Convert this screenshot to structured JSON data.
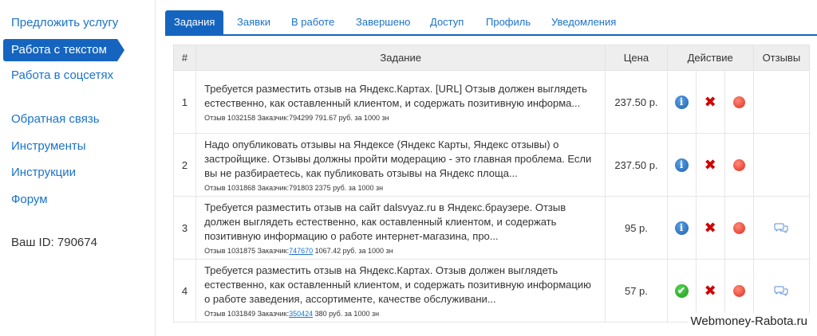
{
  "sidebar": {
    "items": [
      {
        "label": "Предложить услугу"
      },
      {
        "label": "Работа с текстом"
      },
      {
        "label": "Работа в соцсетях"
      },
      {
        "label": "Обратная связь"
      },
      {
        "label": "Инструменты"
      },
      {
        "label": "Инструкции"
      },
      {
        "label": "Форум"
      }
    ],
    "user_id": "Ваш ID: 790674"
  },
  "tabs": [
    {
      "label": "Задания"
    },
    {
      "label": "Заявки"
    },
    {
      "label": "В работе"
    },
    {
      "label": "Завершено"
    },
    {
      "label": "Доступ"
    },
    {
      "label": "Профиль"
    },
    {
      "label": "Уведомления"
    }
  ],
  "table": {
    "headers": {
      "num": "#",
      "task": "Задание",
      "price": "Цена",
      "action": "Действие",
      "reviews": "Отзывы"
    },
    "rows": [
      {
        "num": "1",
        "text": "Требуется разместить отзыв на Яндекс.Картах. [URL] Отзыв должен выглядеть естественно, как оставленный клиентом, и содержать позитивную информа...",
        "meta_prefix": "Отзыв 1032158 Заказчик:",
        "client": "794299",
        "meta_suffix": " 791.67 руб. за 1000 зн",
        "price": "237.50 р.",
        "status": "info"
      },
      {
        "num": "2",
        "text": "Надо опубликовать отзывы на Яндексе (Яндекс Карты, Яндекс отзывы) о застройщике. Отзывы должны пройти модерацию - это главная проблема. Если вы не разбираетесь, как публиковать отзывы на Яндекс площа...",
        "meta_prefix": "Отзыв 1031868 Заказчик:",
        "client": "791803",
        "meta_suffix": " 2375 руб. за 1000 зн",
        "price": "237.50 р.",
        "status": "info"
      },
      {
        "num": "3",
        "text": "Требуется разместить отзыв на сайт dalsvyaz.ru в Яндекс.браузере. Отзыв должен выглядеть естественно, как оставленный клиентом, и содержать позитивную информацию о работе интернет-магазина, про...",
        "meta_prefix": "Отзыв 1031875 Заказчик:",
        "client": "747670",
        "meta_suffix": " 1067.42 руб. за 1000 зн",
        "price": "95 р.",
        "status": "info"
      },
      {
        "num": "4",
        "text": "Требуется разместить отзыв на Яндекс.Картах. Отзыв должен выглядеть естественно, как оставленный клиентом, и содержать позитивную информацию о работе заведения, ассортименте, качестве обслуживани...",
        "meta_prefix": "Отзыв 1031849 Заказчик:",
        "client": "350424",
        "meta_suffix": " 380 руб. за 1000 зн",
        "price": "57 р.",
        "status": "ok"
      }
    ]
  },
  "icons": {
    "info": "i",
    "ok": "✔",
    "cross": "✖"
  },
  "colors": {
    "accent": "#1565c0",
    "link": "#1a73c8",
    "cross": "#d00000"
  },
  "watermark": "Webmoney-Rabota.ru"
}
